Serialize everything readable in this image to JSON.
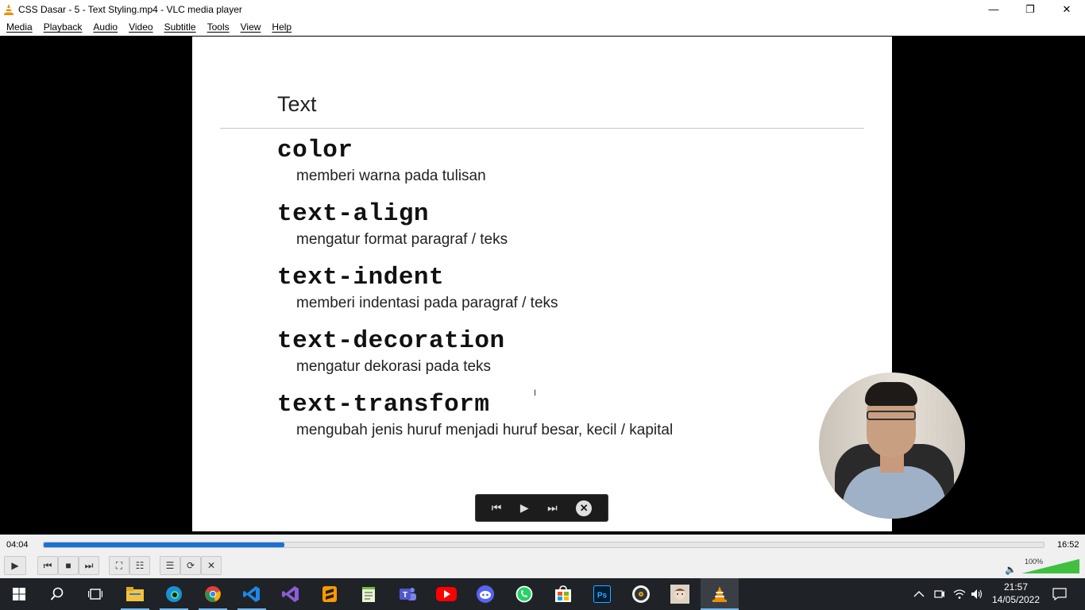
{
  "window": {
    "title": "CSS Dasar - 5 - Text Styling.mp4 - VLC media player",
    "minimize": "—",
    "restore": "❐",
    "close": "✕"
  },
  "menu": {
    "items": [
      "Media",
      "Playback",
      "Audio",
      "Video",
      "Subtitle",
      "Tools",
      "View",
      "Help"
    ]
  },
  "slide": {
    "title": "Text",
    "properties": [
      {
        "name": "color",
        "desc": "memberi warna pada tulisan"
      },
      {
        "name": "text-align",
        "desc": "mengatur format paragraf / teks"
      },
      {
        "name": "text-indent",
        "desc": "memberi indentasi pada paragraf / teks"
      },
      {
        "name": "text-decoration",
        "desc": "mengatur dekorasi pada teks"
      },
      {
        "name": "text-transform",
        "desc": "mengubah jenis huruf menjadi huruf besar, kecil / kapital"
      }
    ]
  },
  "playback": {
    "elapsed": "04:04",
    "total": "16:52",
    "progress_fraction": 0.241,
    "volume_label": "100%",
    "volume_level": 1.0
  },
  "taskbar": {
    "time": "21:57",
    "date": "14/05/2022"
  },
  "colors": {
    "seek_fill": "#1a73d4",
    "volume": "#40c040",
    "taskbar": "#1f2328",
    "vlc_orange": "#f08c00"
  }
}
